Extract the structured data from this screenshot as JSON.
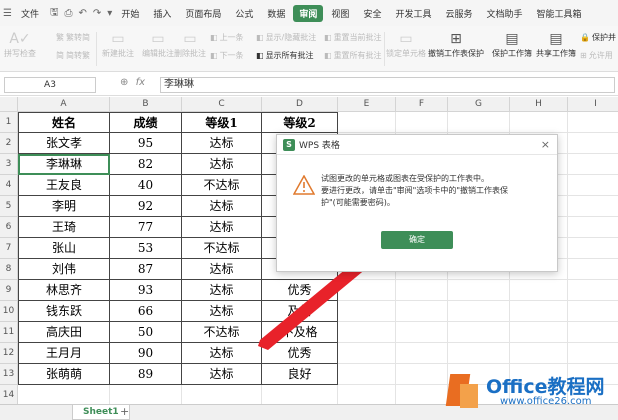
{
  "menubar": {
    "file": "文件",
    "tabs": [
      "开始",
      "插入",
      "页面布局",
      "公式",
      "数据",
      "审阅",
      "视图",
      "安全",
      "开发工具",
      "云服务",
      "文档助手",
      "智能工具箱"
    ],
    "active_tab": "审阅"
  },
  "ribbon": {
    "spellcheck": "拼写检查",
    "simp": "繁转简",
    "trad": "简转繁",
    "new_comment": "新建批注",
    "edit_comment": "编辑批注",
    "delete_comment": "删除批注",
    "prev": "上一条",
    "next": "下一条",
    "show_hide_comment": "显示/隐藏批注",
    "show_all_comments": "显示所有批注",
    "reset_current_comment": "重置当前批注",
    "reset_all_comments": "重置所有批注",
    "lock_cell": "锁定单元格",
    "unprotect_sheet": "撤销工作表保护",
    "protect_workbook": "保护工作簿",
    "share_workbook": "共享工作簿",
    "protect_share": "保护并",
    "allow_edit": "允许用"
  },
  "formula_bar": {
    "cell_ref": "A3",
    "fx": "fx",
    "content": "李琳琳"
  },
  "columns": [
    "A",
    "B",
    "C",
    "D",
    "E",
    "F",
    "G",
    "H",
    "I"
  ],
  "rows": [
    "1",
    "2",
    "3",
    "4",
    "5",
    "6",
    "7",
    "8",
    "9",
    "10",
    "11",
    "12",
    "13",
    "14"
  ],
  "table": {
    "headers": [
      "姓名",
      "成绩",
      "等级1",
      "等级2"
    ],
    "data": [
      [
        "张文孝",
        "95",
        "达标",
        ""
      ],
      [
        "李琳琳",
        "82",
        "达标",
        ""
      ],
      [
        "王友良",
        "40",
        "不达标",
        ""
      ],
      [
        "李明",
        "92",
        "达标",
        ""
      ],
      [
        "王琦",
        "77",
        "达标",
        ""
      ],
      [
        "张山",
        "53",
        "不达标",
        ""
      ],
      [
        "刘伟",
        "87",
        "达标",
        ""
      ],
      [
        "林思齐",
        "93",
        "达标",
        "优秀"
      ],
      [
        "钱东跃",
        "66",
        "达标",
        "及格"
      ],
      [
        "高庆田",
        "50",
        "不达标",
        "不及格"
      ],
      [
        "王月月",
        "90",
        "达标",
        "优秀"
      ],
      [
        "张萌萌",
        "89",
        "达标",
        "良好"
      ]
    ]
  },
  "dialog": {
    "title": "WPS 表格",
    "message_lines": [
      "试图更改的单元格或图表在受保护的工作表中。",
      "要进行更改，请单击\"审阅\"选项卡中的\"撤销工作表保",
      "护\"(可能需要密码)。"
    ],
    "ok": "确定",
    "close": "×"
  },
  "sheet_tab": "Sheet1",
  "add_sheet": "+",
  "watermark": {
    "brand": "Office教程网",
    "url": "www.office26.com"
  },
  "colors": {
    "accent": "#3e8e58",
    "arrow": "#e8222a",
    "warning": "#e07a2e"
  }
}
